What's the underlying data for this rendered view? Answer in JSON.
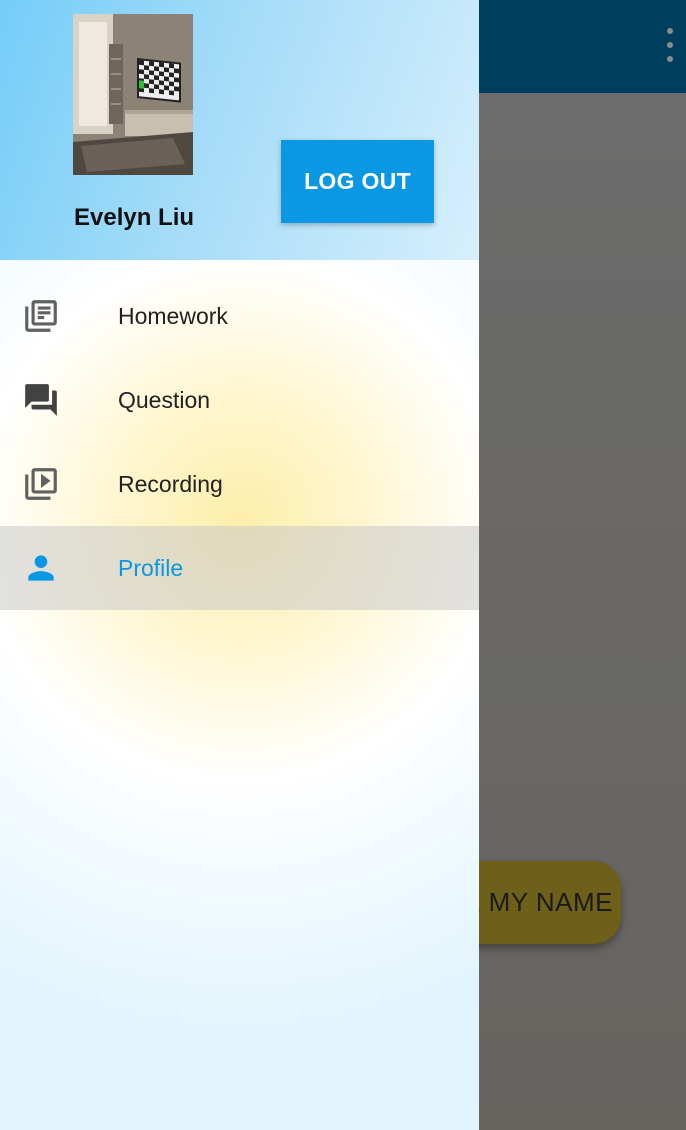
{
  "background": {
    "change_name_label": "E MY NAME"
  },
  "drawer": {
    "user_name": "Evelyn Liu",
    "logout_label": "LOG OUT",
    "items": [
      {
        "label": "Homework",
        "icon": "library-books-icon",
        "active": false
      },
      {
        "label": "Question",
        "icon": "forum-icon",
        "active": false
      },
      {
        "label": "Recording",
        "icon": "video-library-icon",
        "active": false
      },
      {
        "label": "Profile",
        "icon": "person-icon",
        "active": true
      }
    ]
  },
  "colors": {
    "accent": "#0a97e3",
    "app_bar": "#003e5e",
    "icon_gray": "#616161"
  }
}
